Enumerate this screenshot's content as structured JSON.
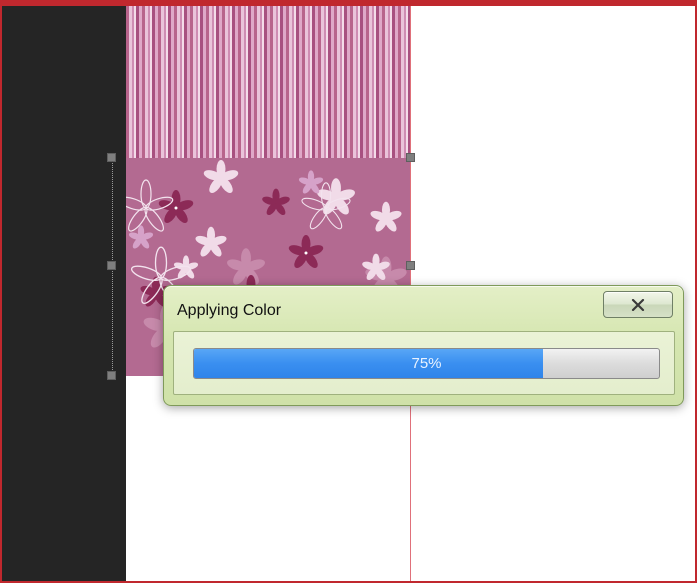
{
  "dialog": {
    "title": "Applying Color",
    "close_icon": "close-icon",
    "progress": {
      "percent": 75,
      "label": "75%"
    }
  },
  "colors": {
    "dark_panel": "#252525",
    "frame_border": "#c0282e",
    "dialog_bg": "#d5e6b0",
    "progress_fill": "#3a8ff0"
  }
}
